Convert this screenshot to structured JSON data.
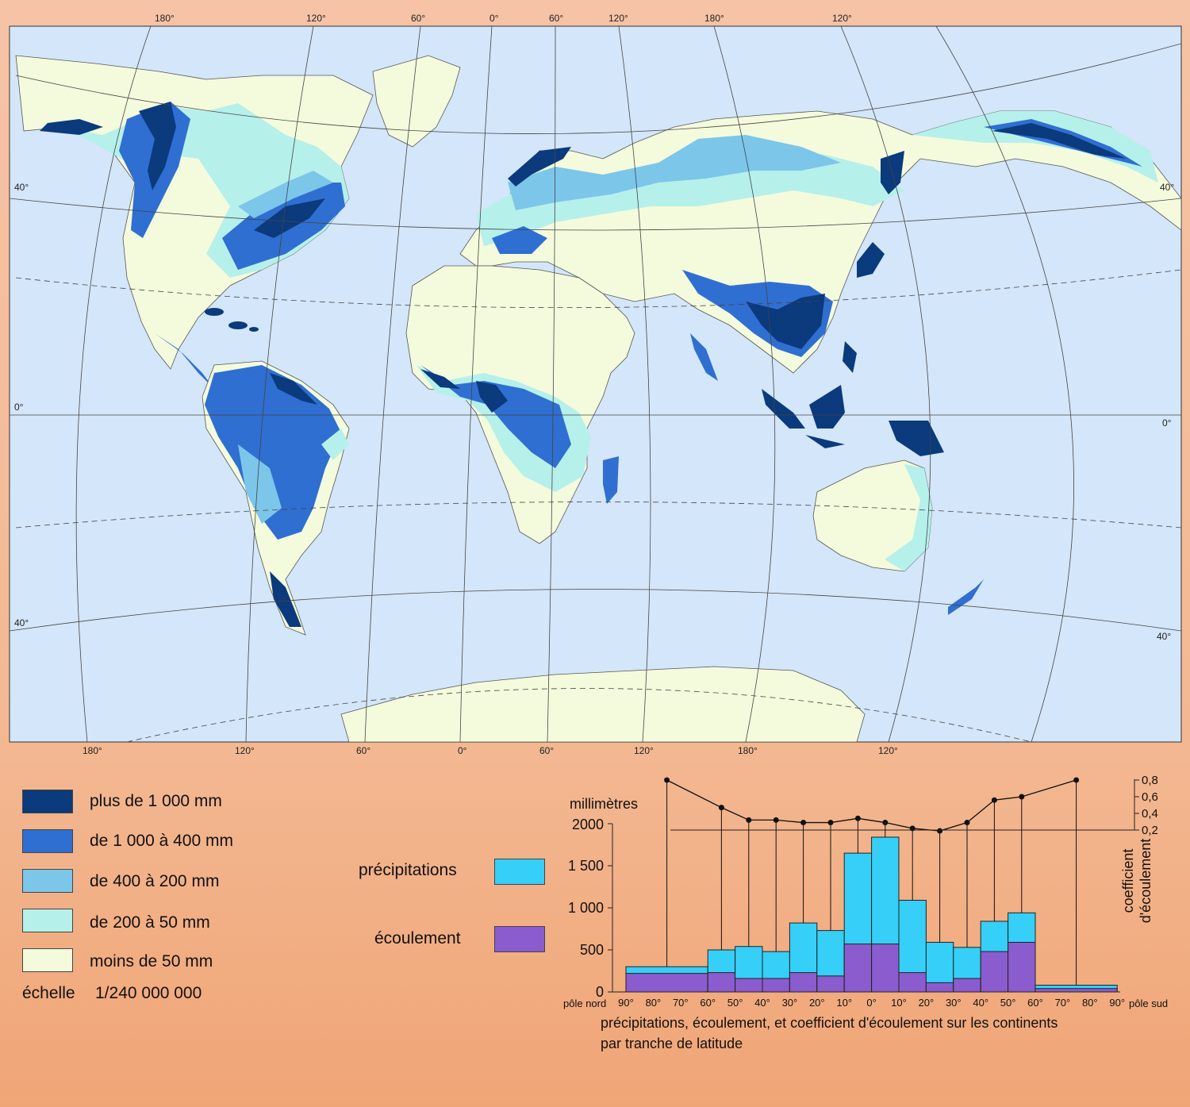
{
  "map": {
    "top_meridian_labels": [
      "180°",
      "120°",
      "60°",
      "0°",
      "60°",
      "120°",
      "180°",
      "120°"
    ],
    "bottom_meridian_labels": [
      "180°",
      "120°",
      "60°",
      "0°",
      "60°",
      "120°",
      "180°",
      "120°"
    ],
    "parallel_labels": {
      "north40_left": "40°",
      "north40_right": "40°",
      "equator_left": "0°",
      "equator_right": "0°",
      "south40_left": "40°",
      "south40_right": "40°"
    },
    "colors": {
      "ocean": "#d4e6f9",
      "lt50": "#f4fbdc",
      "r50_200": "#b6f0ea",
      "r200_400": "#7cc6ea",
      "r400_1000": "#2f6fd1",
      "gt1000": "#0b3a7d"
    }
  },
  "legend": {
    "items": [
      {
        "label": "plus de 1 000 mm",
        "color": "#0b3a7d"
      },
      {
        "label": "de 1 000 à 400 mm",
        "color": "#2f6fd1"
      },
      {
        "label": "de 400 à 200 mm",
        "color": "#7cc6ea"
      },
      {
        "label": "de 200 à 50 mm",
        "color": "#b6f0ea"
      },
      {
        "label": "moins de 50 mm",
        "color": "#f4fbdc"
      }
    ],
    "scale_label": "échelle",
    "scale_value": "1/240 000 000",
    "precip_label": "précipitations",
    "precip_color": "#35cff7",
    "runoff_label": "écoulement",
    "runoff_color": "#8a5cce"
  },
  "chart_data": {
    "type": "bar",
    "title": "précipitations, écoulement, et coefficient d'écoulement  sur les continents",
    "subtitle": "par tranche de latitude",
    "ylabel": "millimètres",
    "y2label_line1": "coefficient",
    "y2label_line2": "d'écoulement",
    "ylim": [
      0,
      2000
    ],
    "y_ticks": [
      "0",
      "500",
      "1 000",
      "1 500",
      "2000"
    ],
    "y2_ticks": [
      "0,2",
      "0,4",
      "0,6",
      "0,8"
    ],
    "x_ticks": [
      "90°",
      "80°",
      "70°",
      "60°",
      "50°",
      "40°",
      "30°",
      "20°",
      "10°",
      "0°",
      "10°",
      "20°",
      "30°",
      "40°",
      "50°",
      "60°",
      "70°",
      "80°",
      "90°"
    ],
    "x_left_note": "pôle nord",
    "x_right_note": "pôle sud",
    "bands": [
      {
        "from": 90,
        "to": 60,
        "precip": 300,
        "runoff": 220
      },
      {
        "from": 60,
        "to": 50,
        "precip": 500,
        "runoff": 230
      },
      {
        "from": 50,
        "to": 40,
        "precip": 540,
        "runoff": 160
      },
      {
        "from": 40,
        "to": 30,
        "precip": 480,
        "runoff": 160
      },
      {
        "from": 30,
        "to": 20,
        "precip": 820,
        "runoff": 230
      },
      {
        "from": 20,
        "to": 10,
        "precip": 730,
        "runoff": 190
      },
      {
        "from": 10,
        "to": 0,
        "precip": 1650,
        "runoff": 570
      },
      {
        "from": 0,
        "to": -10,
        "precip": 1840,
        "runoff": 570
      },
      {
        "from": -10,
        "to": -20,
        "precip": 1090,
        "runoff": 230
      },
      {
        "from": -20,
        "to": -30,
        "precip": 590,
        "runoff": 110
      },
      {
        "from": -30,
        "to": -40,
        "precip": 530,
        "runoff": 160
      },
      {
        "from": -40,
        "to": -50,
        "precip": 840,
        "runoff": 480
      },
      {
        "from": -50,
        "to": -60,
        "precip": 940,
        "runoff": 590
      },
      {
        "from": -60,
        "to": -90,
        "precip": 80,
        "runoff": 40
      }
    ],
    "coefficient": [
      {
        "lat": 75,
        "value": 0.8
      },
      {
        "lat": 55,
        "value": 0.47
      },
      {
        "lat": 45,
        "value": 0.32
      },
      {
        "lat": 35,
        "value": 0.32
      },
      {
        "lat": 25,
        "value": 0.29
      },
      {
        "lat": 15,
        "value": 0.29
      },
      {
        "lat": 5,
        "value": 0.34
      },
      {
        "lat": -5,
        "value": 0.29
      },
      {
        "lat": -15,
        "value": 0.22
      },
      {
        "lat": -25,
        "value": 0.19
      },
      {
        "lat": -35,
        "value": 0.29
      },
      {
        "lat": -45,
        "value": 0.56
      },
      {
        "lat": -55,
        "value": 0.6
      },
      {
        "lat": -75,
        "value": 0.8
      }
    ]
  }
}
